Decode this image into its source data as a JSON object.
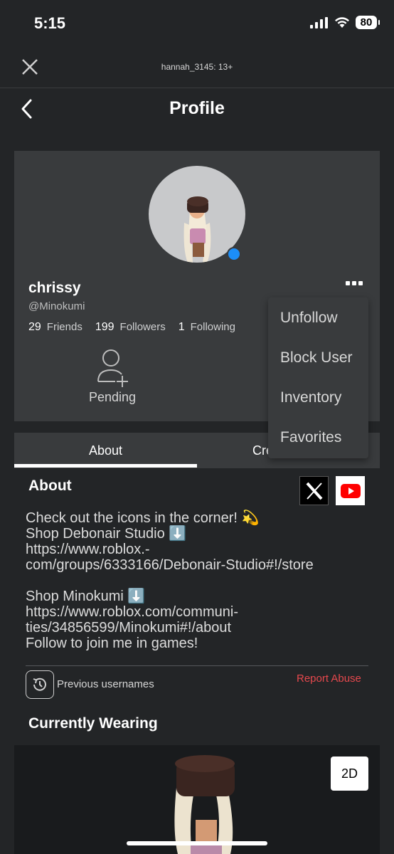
{
  "status_bar": {
    "time": "5:15",
    "battery": "80"
  },
  "top_bar": {
    "account_label": "hannah_3145: 13+"
  },
  "header": {
    "title": "Profile"
  },
  "profile": {
    "display_name": "chrissy",
    "username": "@Minokumi",
    "stats": [
      {
        "count": "29",
        "label": "Friends"
      },
      {
        "count": "199",
        "label": "Followers"
      },
      {
        "count": "1",
        "label": "Following"
      }
    ],
    "pending_label": "Pending",
    "online_color": "#1c8ef8"
  },
  "menu": {
    "items": [
      "Unfollow",
      "Block User",
      "Inventory",
      "Favorites"
    ]
  },
  "tabs": {
    "about": "About",
    "creations": "Cre"
  },
  "about": {
    "heading": "About",
    "body": "Check out the icons in the corner! 💫\nShop Debonair Studio ⬇️\nhttps://www.roblox.-\ncom/groups/6333166/Debonair-Studio#!/store\n\nShop Minokumi ⬇️\nhttps://www.roblox.com/communi-\nties/34856599/Minokumi#!/about\nFollow to join me in games!",
    "previous_usernames": "Previous usernames",
    "report_abuse": "Report Abuse"
  },
  "wearing": {
    "heading": "Currently Wearing",
    "view_toggle": "2D"
  }
}
